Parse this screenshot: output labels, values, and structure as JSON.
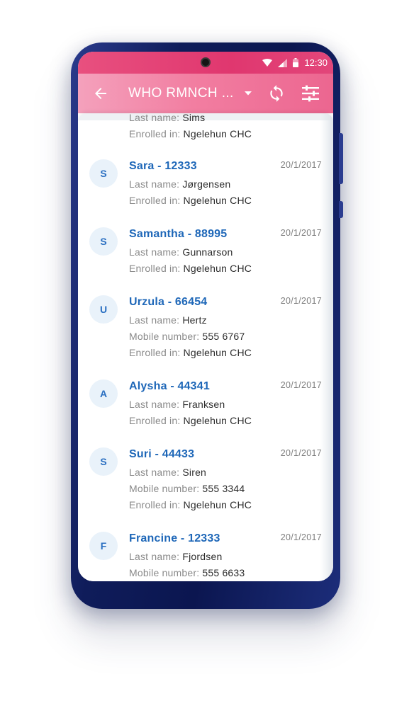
{
  "statusbar": {
    "time": "12:30"
  },
  "appbar": {
    "title": "WHO RMNCH ...",
    "icons": {
      "back": "arrow-back-icon",
      "dropdown": "caret-down-icon",
      "sync": "sync-icon",
      "filter": "filter-icon"
    }
  },
  "labels": {
    "last_name": "Last name:",
    "enrolled_in": "Enrolled in:",
    "mobile_number": "Mobile number:"
  },
  "partial_item": {
    "last_name": "Sims",
    "enrolled_in": "Ngelehun CHC"
  },
  "items": [
    {
      "initial": "S",
      "title": "Sara - 12333",
      "date": "20/1/2017",
      "last_name": "Jørgensen",
      "enrolled_in": "Ngelehun CHC"
    },
    {
      "initial": "S",
      "title": "Samantha - 88995",
      "date": "20/1/2017",
      "last_name": "Gunnarson",
      "enrolled_in": "Ngelehun CHC"
    },
    {
      "initial": "U",
      "title": "Urzula - 66454",
      "date": "20/1/2017",
      "last_name": "Hertz",
      "mobile_number": "555 6767",
      "enrolled_in": "Ngelehun CHC"
    },
    {
      "initial": "A",
      "title": "Alysha - 44341",
      "date": "20/1/2017",
      "last_name": "Franksen",
      "enrolled_in": "Ngelehun CHC"
    },
    {
      "initial": "S",
      "title": "Suri - 44433",
      "date": "20/1/2017",
      "last_name": "Siren",
      "mobile_number": "555 3344",
      "enrolled_in": "Ngelehun CHC"
    },
    {
      "initial": "F",
      "title": "Francine - 12333",
      "date": "20/1/2017",
      "last_name": "Fjordsen",
      "mobile_number": "555 6633"
    }
  ]
}
